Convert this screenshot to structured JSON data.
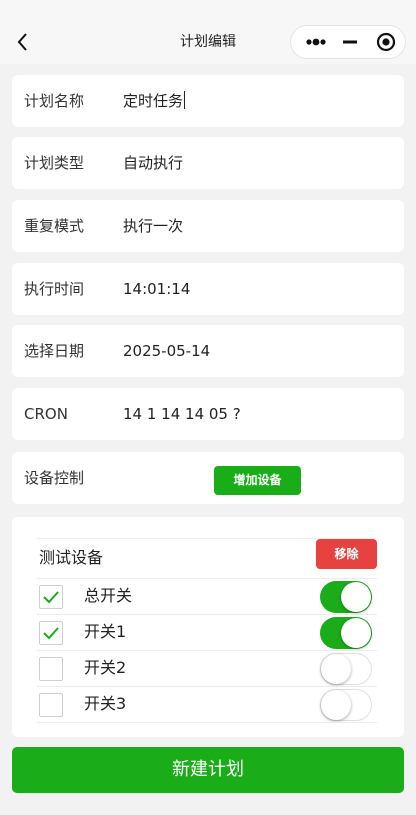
{
  "navbar": {
    "title": "计划编辑",
    "back_icon": "chevron-left-icon",
    "more_icon": "more-dots-icon",
    "minimize_icon": "minimize-icon",
    "close_icon": "record-close-icon"
  },
  "form": {
    "plan_name": {
      "label": "计划名称",
      "value": "定时任务"
    },
    "plan_type": {
      "label": "计划类型",
      "value": "自动执行"
    },
    "repeat_mode": {
      "label": "重复模式",
      "value": "执行一次"
    },
    "exec_time": {
      "label": "执行时间",
      "value": "14:01:14"
    },
    "select_date": {
      "label": "选择日期",
      "value": "2025-05-14"
    },
    "cron": {
      "label": "CRON",
      "value": "14 1 14 14 05 ?"
    },
    "device_control": {
      "label": "设备控制",
      "add_button": "增加设备"
    }
  },
  "device": {
    "name": "测试设备",
    "remove_button": "移除",
    "switches": [
      {
        "label": "总开关",
        "checked": true,
        "on": true
      },
      {
        "label": "开关1",
        "checked": true,
        "on": true
      },
      {
        "label": "开关2",
        "checked": false,
        "on": false
      },
      {
        "label": "开关3",
        "checked": false,
        "on": false
      }
    ]
  },
  "submit_button": "新建计划",
  "colors": {
    "primary_green": "#1aad19",
    "danger_red": "#e64340",
    "background": "#f2f2f2",
    "card": "#ffffff"
  }
}
